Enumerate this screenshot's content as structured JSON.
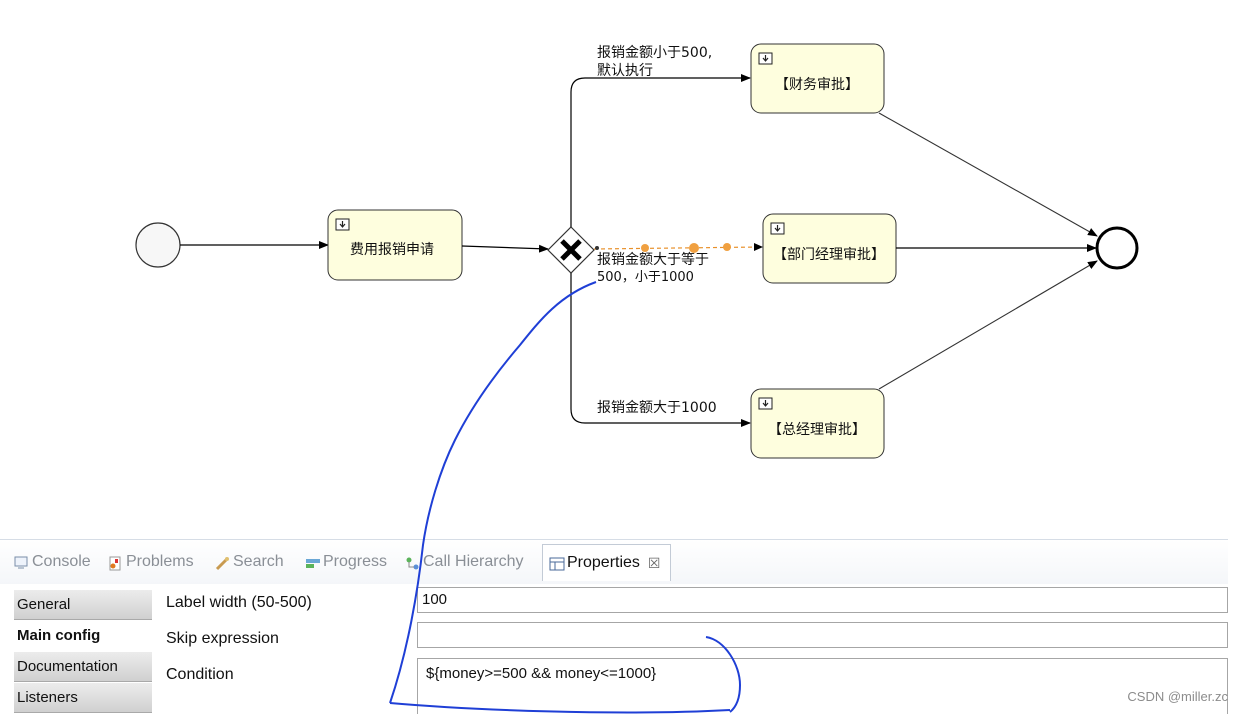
{
  "diagram": {
    "tasks": {
      "apply": "费用报销申请",
      "finance": "【财务审批】",
      "dept_manager": "【部门经理审批】",
      "general_manager": "【总经理审批】"
    },
    "flows": {
      "under_500_line1": "报销金额小于500,",
      "under_500_line2": "默认执行",
      "mid_line1": "报销金额大于等于",
      "mid_line2": "500，小于1000",
      "over_1000": "报销金额大于1000"
    },
    "icons": {
      "start_event": "start-event-circle",
      "end_event": "end-event-bold-circle",
      "gateway": "exclusive-gateway-x",
      "task_marker": "user-task-marker"
    },
    "colors": {
      "task_fill": "#fefede",
      "selected_flow": "#e8902a",
      "annotation_ink": "#1f3fd6"
    }
  },
  "tabs": {
    "console": "Console",
    "problems": "Problems",
    "search": "Search",
    "progress": "Progress",
    "call_hierarchy": "Call Hierarchy",
    "properties": "Properties",
    "close_glyph": "☒"
  },
  "properties": {
    "side_tabs": {
      "general": "General",
      "main_config": "Main config",
      "documentation": "Documentation",
      "listeners": "Listeners"
    },
    "fields": {
      "label_width": {
        "label": "Label width (50-500)",
        "value": "100"
      },
      "skip_expression": {
        "label": "Skip expression",
        "value": ""
      },
      "condition": {
        "label": "Condition",
        "value": "${money>=500 && money<=1000}"
      }
    }
  },
  "watermark": "CSDN @miller.zc"
}
